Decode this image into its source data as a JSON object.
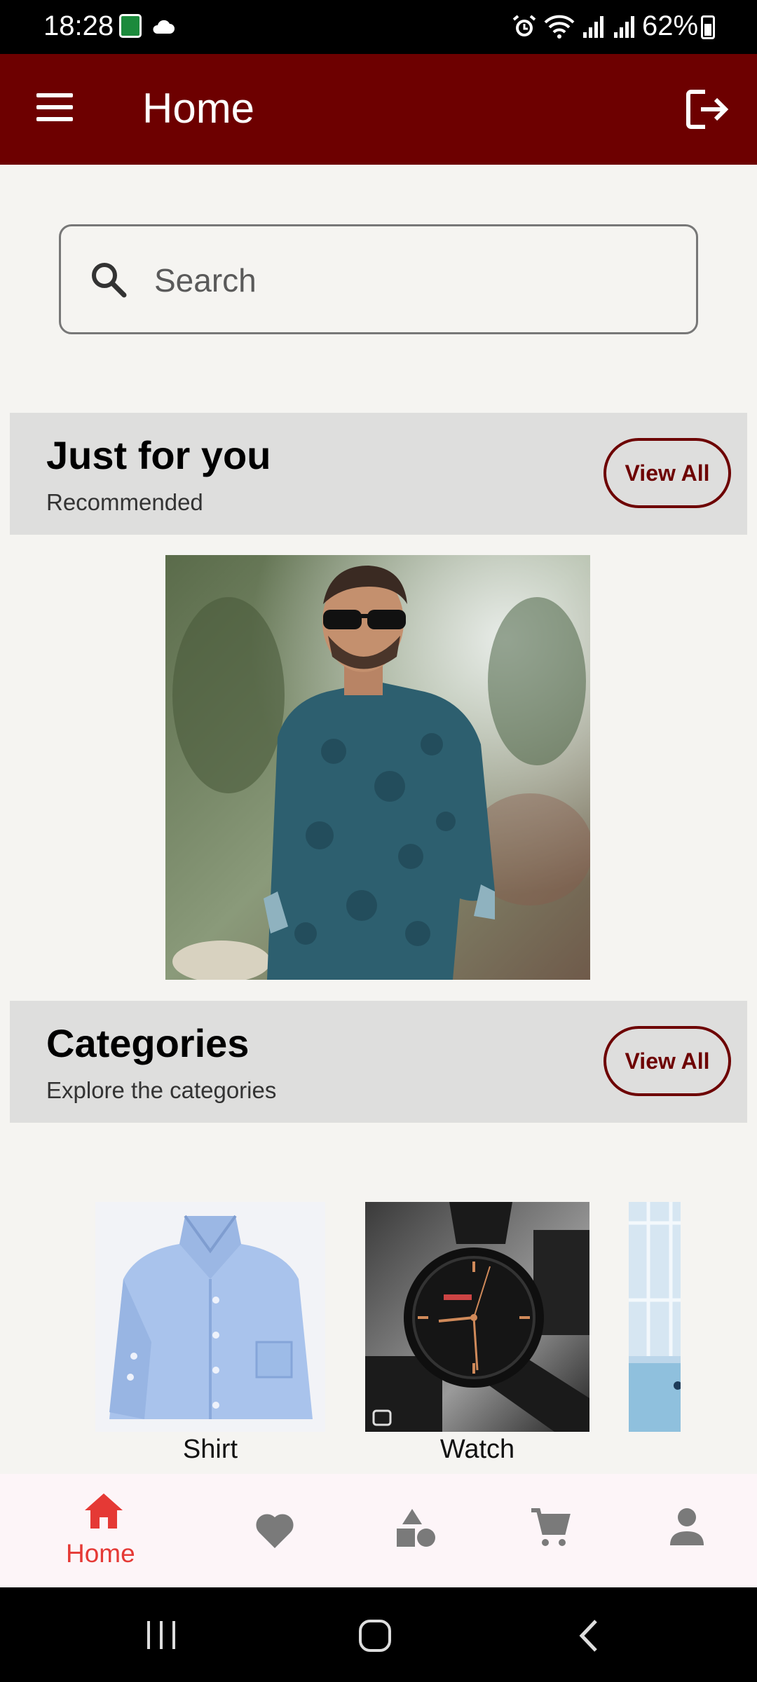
{
  "status_bar": {
    "time": "18:28",
    "battery": "62%",
    "icons": [
      "notification-icon",
      "cloud-icon",
      "alarm-icon",
      "wifi-icon",
      "signal-icon",
      "signal-icon",
      "battery-icon"
    ]
  },
  "app_bar": {
    "title": "Home",
    "menu_icon": "hamburger-menu-icon",
    "logout_icon": "logout-icon"
  },
  "search": {
    "placeholder": "Search",
    "value": ""
  },
  "just_for_you": {
    "title": "Just for you",
    "subtitle": "Recommended",
    "view_all_label": "View All"
  },
  "categories": {
    "title": "Categories",
    "subtitle": "Explore the categories",
    "view_all_label": "View All",
    "items": [
      {
        "label": "Shirt"
      },
      {
        "label": "Watch"
      },
      {
        "label": ""
      }
    ]
  },
  "bottom_nav": {
    "items": [
      {
        "label": "Home",
        "icon": "home-icon",
        "active": true
      },
      {
        "label": "",
        "icon": "heart-icon",
        "active": false
      },
      {
        "label": "",
        "icon": "shapes-icon",
        "active": false
      },
      {
        "label": "",
        "icon": "cart-icon",
        "active": false
      },
      {
        "label": "",
        "icon": "person-icon",
        "active": false
      }
    ]
  },
  "colors": {
    "primary": "#6d0000",
    "accent": "#e53935",
    "section_bg": "#dededd",
    "background": "#f5f4f1",
    "inactive_icon": "#7a7a7a"
  }
}
